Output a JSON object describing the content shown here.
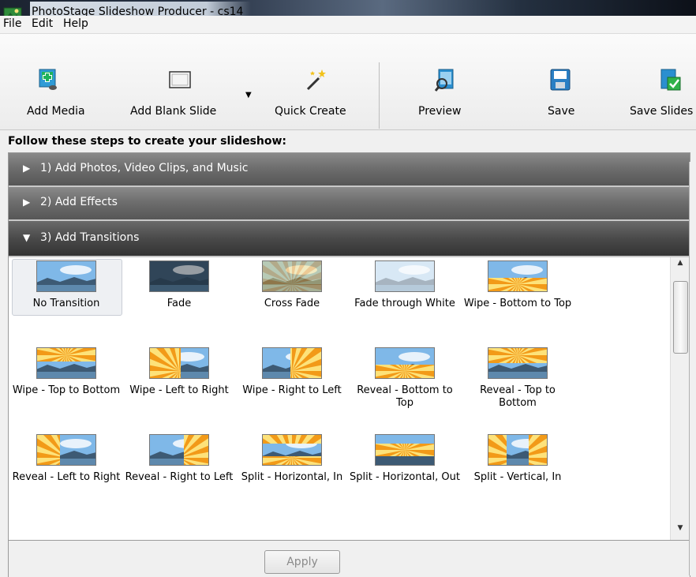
{
  "window": {
    "title": "PhotoStage Slideshow Producer - cs14"
  },
  "menu": {
    "items": [
      "File",
      "Edit",
      "Help"
    ]
  },
  "toolbar": {
    "add_media": "Add Media",
    "add_blank_slide": "Add Blank Slide",
    "quick_create": "Quick Create",
    "preview": "Preview",
    "save": "Save",
    "save_slideshow": "Save Slides"
  },
  "steps": {
    "header": "Follow these steps to create your slideshow:",
    "items": [
      {
        "label": "1)   Add Photos, Video Clips, and Music",
        "expanded": false
      },
      {
        "label": "2)   Add Effects",
        "expanded": false
      },
      {
        "label": "3)   Add Transitions",
        "expanded": true
      }
    ]
  },
  "transitions": [
    {
      "label": "No Transition",
      "selected": true
    },
    {
      "label": "Fade"
    },
    {
      "label": "Cross Fade"
    },
    {
      "label": "Fade through White"
    },
    {
      "label": "Wipe - Bottom to Top"
    },
    {
      "label": "Wipe - Top to Bottom"
    },
    {
      "label": "Wipe - Left to Right"
    },
    {
      "label": "Wipe - Right to Left"
    },
    {
      "label": "Reveal - Bottom to Top"
    },
    {
      "label": "Reveal - Top to Bottom"
    },
    {
      "label": "Reveal - Left to Right"
    },
    {
      "label": "Reveal - Right to Left"
    },
    {
      "label": "Split - Horizontal, In"
    },
    {
      "label": "Split - Horizontal, Out"
    },
    {
      "label": "Split - Vertical, In"
    }
  ],
  "apply_label": "Apply",
  "colors": {
    "step_bar": "#6e6e6e",
    "step_bar_open": "#3a3a3a",
    "sky": "#7fb8e8",
    "sunburst": "#f2a21a"
  }
}
